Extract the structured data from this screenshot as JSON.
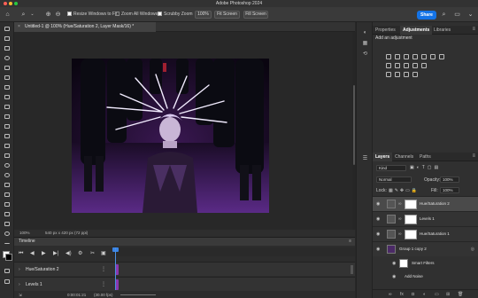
{
  "app": {
    "title": "Adobe Photoshop 2024"
  },
  "options_bar": {
    "resize_windows": "Resize Windows to Fit",
    "zoom_all": "Zoom All Windows",
    "scrubby_zoom": "Scrubby Zoom",
    "zoom_value": "100%",
    "fit_screen": "Fit Screen",
    "fill_screen": "Fill Screen",
    "share": "Share"
  },
  "document": {
    "tab_title": "Untitled-1 @ 100% (Hue/Saturation 2, Layer Mask/16) *",
    "zoom": "100%",
    "dimensions": "540 px x 420 px (72 ppi)"
  },
  "timeline": {
    "title": "Timeline",
    "tracks": [
      {
        "name": "Hue/Saturation 2"
      },
      {
        "name": "Levels 1"
      }
    ],
    "timecode": "0:00:01:21",
    "fps": "(30.00 fps)"
  },
  "panels": {
    "top_tabs": [
      "Properties",
      "Adjustments",
      "Libraries"
    ],
    "active_top_tab": "Adjustments",
    "add_adjustment": "Add an adjustment",
    "layer_tabs": [
      "Layers",
      "Channels",
      "Paths"
    ],
    "kind_filter": "Kind",
    "blend_mode": "Normal",
    "opacity_label": "Opacity:",
    "opacity_value": "100%",
    "lock_label": "Lock:",
    "fill_label": "Fill:",
    "fill_value": "100%"
  },
  "layers": [
    {
      "name": "Hue/Saturation 2",
      "selected": true
    },
    {
      "name": "Levels 1",
      "selected": false
    },
    {
      "name": "Hue/Saturation 1",
      "selected": false
    },
    {
      "name": "Group 1 copy 2",
      "selected": false
    }
  ],
  "smart_filters": {
    "label": "Smart Filters",
    "filter": "Add Noise"
  },
  "colors": {
    "accent": "#1473e6",
    "clip": "#8b38b0",
    "selected_layer": "#4a4a4a"
  }
}
